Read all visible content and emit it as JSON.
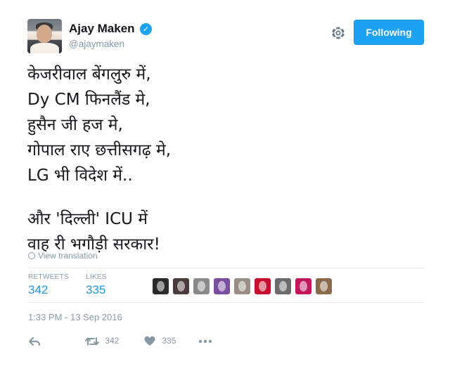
{
  "user": {
    "name": "Ajay Maken",
    "handle": "@ajaymaken",
    "verified": true
  },
  "follow_button": {
    "label": "Following",
    "color": "#1da1f2"
  },
  "tweet": {
    "lines": [
      "केजरीवाल बेंगलुरु में,",
      "Dy CM फिनलैंड मे,",
      "हुसैन जी हज मे,",
      "गोपाल राए छत्तीसगढ़ मे,",
      "LG भी विदेश में.."
    ],
    "lines2": [
      "और 'दिल्ली' ICU में",
      "वाह री भगौड़ी सरकार!"
    ]
  },
  "view_translation": "View translation",
  "stats": {
    "retweets_label": "RETWEETS",
    "retweets_value": "342",
    "likes_label": "LIKES",
    "likes_value": "335"
  },
  "likers": [
    {
      "icon": "liker-avatar",
      "color": "#2b2b2b"
    },
    {
      "icon": "liker-avatar",
      "color": "#4a3a3a"
    },
    {
      "icon": "liker-avatar",
      "color": "#8a8a8a"
    },
    {
      "icon": "liker-avatar",
      "color": "#7b4fa0"
    },
    {
      "icon": "liker-avatar",
      "color": "#9a8c86"
    },
    {
      "icon": "liker-avatar",
      "color": "#c8102e"
    },
    {
      "icon": "liker-avatar",
      "color": "#6b6b6b"
    },
    {
      "icon": "liker-avatar",
      "color": "#c2185b"
    },
    {
      "icon": "liker-avatar",
      "color": "#8a6a4a"
    }
  ],
  "timestamp": "1:33 PM - 13 Sep 2016",
  "actions": {
    "reply_icon": "reply-icon",
    "retweet_icon": "retweet-icon",
    "retweet_count": "342",
    "like_icon": "heart-icon",
    "like_count": "335",
    "more_icon": "more-icon"
  },
  "colors": {
    "accent": "#1da1f2",
    "secondary_text": "#8899a6",
    "stat_value": "#1b95e0"
  }
}
